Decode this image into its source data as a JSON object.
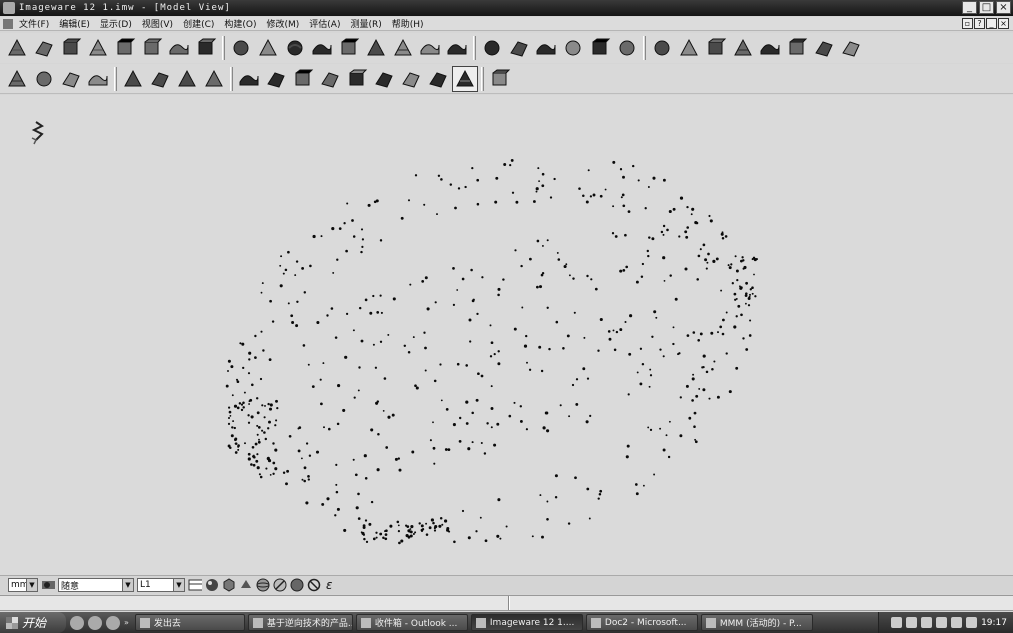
{
  "window": {
    "title": "Imageware 12    1.imw - [Model View]",
    "buttons": {
      "minimize": "_",
      "maximize": "□",
      "close": "×"
    }
  },
  "menu": {
    "items": [
      "文件(F)",
      "编辑(E)",
      "显示(D)",
      "视图(V)",
      "创建(C)",
      "构建(O)",
      "修改(M)",
      "评估(A)",
      "测量(R)",
      "帮助(H)"
    ]
  },
  "toolbar_row1": {
    "groups": [
      [
        "surface-tool-icon",
        "mesh-tool-icon",
        "sweep-tool-icon",
        "boundary-tool-icon",
        "cube-tool-icon",
        "blend-tool-icon",
        "loft-tool-icon",
        "revolve-tool-icon"
      ],
      [
        "plane-tool-icon",
        "offset-surface-icon",
        "extend-surface-icon",
        "fillet-surface-icon",
        "flange-tool-icon",
        "stack-tool-icon",
        "trim-tool-icon",
        "cylinder-tool-icon",
        "cone-tool-icon"
      ],
      [
        "bounding-box-icon",
        "section-icon",
        "network-icon",
        "solid-icon",
        "split-icon",
        "triangle-icon"
      ],
      [
        "wave-surface-icon",
        "gear-surface-icon",
        "shell-tool-icon",
        "deform-tool-icon",
        "sheet-tool-icon",
        "align-tool-icon",
        "checker-icon",
        "curvature-icon"
      ]
    ]
  },
  "toolbar_row2": {
    "groups": [
      [
        "extrude-tool-icon",
        "layer-tool-icon",
        "offset-layer-icon",
        "cut-tool-icon"
      ],
      [
        "cloud-icon",
        "spline-icon",
        "blob-icon",
        "arc-curve-icon"
      ],
      [
        "grid-icon",
        "lightning-icon",
        "curve-edit-icon",
        "polyline-icon",
        "snap-icon",
        "freeform-curve-icon",
        "point-edit-icon",
        "delete-tool-icon",
        "wheel-tool-icon"
      ],
      [
        "palette-icon"
      ]
    ],
    "active": "wheel-tool-icon"
  },
  "viewport": {
    "axis_icon": "axis-triad-icon",
    "point_cloud_color": "#0a0a0a"
  },
  "controls": {
    "units": "mm",
    "layer_mode": "随意",
    "layer": "L1",
    "epsilon": "ε"
  },
  "taskbar": {
    "start": "开始",
    "quicklaunch_more": "»",
    "tasks": [
      {
        "label": "发出去",
        "width": 110
      },
      {
        "label": "基于逆向技术的产品...",
        "width": 105
      },
      {
        "label": "收件箱 - Outlook ...",
        "width": 112
      },
      {
        "label": "Imageware 12   1....",
        "width": 112,
        "active": true
      },
      {
        "label": "Doc2 - Microsoft...",
        "width": 112
      },
      {
        "label": "MMM (活动的) - P...",
        "width": 112
      }
    ],
    "clock": "19:17"
  }
}
